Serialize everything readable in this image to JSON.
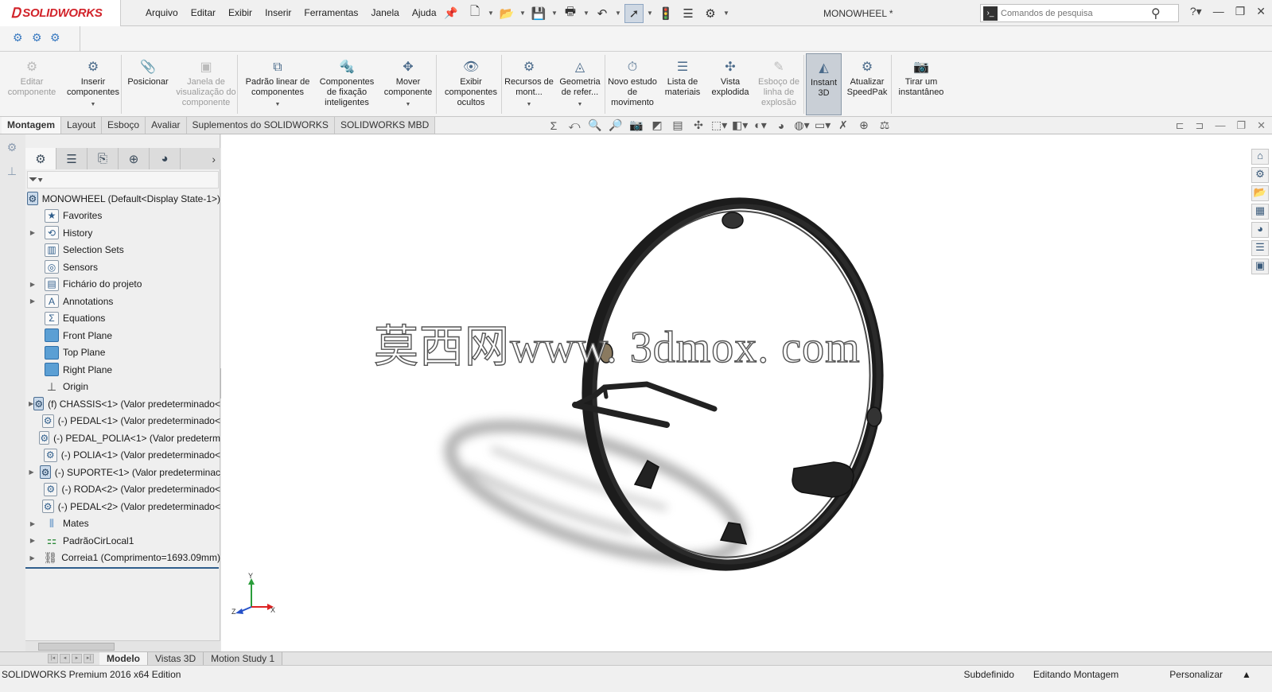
{
  "app": {
    "logo": "SOLIDWORKS",
    "document_title": "MONOWHEEL *",
    "menu": [
      "Arquivo",
      "Editar",
      "Exibir",
      "Inserir",
      "Ferramentas",
      "Janela",
      "Ajuda"
    ],
    "search_placeholder": "Comandos de pesquisa"
  },
  "command_manager": [
    {
      "label": "Editar componente",
      "disabled": true,
      "icon": "edit-component-icon"
    },
    {
      "label": "Inserir componentes",
      "disabled": false,
      "icon": "insert-components-icon",
      "caret": true
    },
    {
      "label": "Posicionar",
      "disabled": false,
      "icon": "mate-icon"
    },
    {
      "label": "Janela de visualização do componente",
      "disabled": true,
      "icon": "component-preview-icon"
    },
    {
      "label": "Padrão linear de componentes",
      "disabled": false,
      "icon": "linear-pattern-icon",
      "caret": true
    },
    {
      "label": "Componentes de fixação inteligentes",
      "disabled": false,
      "icon": "smart-fasteners-icon"
    },
    {
      "label": "Mover componente",
      "disabled": false,
      "icon": "move-component-icon",
      "caret": true
    },
    {
      "label": "Exibir componentes ocultos",
      "disabled": false,
      "icon": "show-hidden-icon"
    },
    {
      "label": "Recursos de mont...",
      "disabled": false,
      "icon": "assembly-features-icon",
      "caret": true
    },
    {
      "label": "Geometria de refer...",
      "disabled": false,
      "icon": "reference-geometry-icon",
      "caret": true
    },
    {
      "label": "Novo estudo de movimento",
      "disabled": false,
      "icon": "motion-study-icon"
    },
    {
      "label": "Lista de materiais",
      "disabled": false,
      "icon": "bom-icon"
    },
    {
      "label": "Vista explodida",
      "disabled": false,
      "icon": "exploded-view-icon"
    },
    {
      "label": "Esboço de linha de explosão",
      "disabled": true,
      "icon": "explode-line-sketch-icon"
    },
    {
      "label": "Instant 3D",
      "disabled": false,
      "active": true,
      "icon": "instant-3d-icon"
    },
    {
      "label": "Atualizar SpeedPak",
      "disabled": false,
      "icon": "speedpak-icon"
    },
    {
      "label": "Tirar um instantâneo",
      "disabled": false,
      "icon": "snapshot-icon"
    }
  ],
  "command_tabs": [
    "Montagem",
    "Layout",
    "Esboço",
    "Avaliar",
    "Suplementos do SOLIDWORKS",
    "SOLIDWORKS MBD"
  ],
  "active_command_tab": "Montagem",
  "tree": {
    "root": "MONOWHEEL  (Default<Display State-1>)",
    "items": [
      {
        "label": "Favorites",
        "expandable": false,
        "icon": "favorites-icon"
      },
      {
        "label": "History",
        "expandable": true,
        "icon": "history-icon"
      },
      {
        "label": "Selection Sets",
        "expandable": false,
        "icon": "selection-sets-icon"
      },
      {
        "label": "Sensors",
        "expandable": false,
        "icon": "sensors-icon"
      },
      {
        "label": "Fichário do projeto",
        "expandable": true,
        "icon": "design-binder-icon"
      },
      {
        "label": "Annotations",
        "expandable": true,
        "icon": "annotations-icon"
      },
      {
        "label": "Equations",
        "expandable": false,
        "icon": "equations-icon"
      },
      {
        "label": "Front Plane",
        "expandable": false,
        "icon": "plane-icon"
      },
      {
        "label": "Top Plane",
        "expandable": false,
        "icon": "plane-icon"
      },
      {
        "label": "Right Plane",
        "expandable": false,
        "icon": "plane-icon"
      },
      {
        "label": "Origin",
        "expandable": false,
        "icon": "origin-icon"
      },
      {
        "label": "(f) CHASSIS<1> (Valor predeterminado<",
        "expandable": true,
        "icon": "subassembly-icon"
      },
      {
        "label": "(-) PEDAL<1> (Valor predeterminado<",
        "expandable": false,
        "icon": "part-icon"
      },
      {
        "label": "(-) PEDAL_POLIA<1> (Valor predeterm",
        "expandable": false,
        "icon": "part-icon"
      },
      {
        "label": "(-) POLIA<1> (Valor predeterminado<",
        "expandable": false,
        "icon": "part-icon"
      },
      {
        "label": "(-) SUPORTE<1> (Valor predeterminac",
        "expandable": true,
        "icon": "subassembly-icon"
      },
      {
        "label": "(-) RODA<2> (Valor predeterminado<",
        "expandable": false,
        "icon": "part-icon"
      },
      {
        "label": "(-) PEDAL<2> (Valor predeterminado<",
        "expandable": false,
        "icon": "part-icon"
      },
      {
        "label": "Mates",
        "expandable": true,
        "icon": "mates-icon"
      },
      {
        "label": "PadrãoCirLocal1",
        "expandable": true,
        "icon": "circular-pattern-icon"
      },
      {
        "label": "Correia1 (Comprimento=1693.09mm)",
        "expandable": true,
        "icon": "belt-icon"
      }
    ]
  },
  "graphics": {
    "watermark": "莫西网www. 3dmox. com",
    "triad": {
      "x": "X",
      "y": "Y",
      "z": "Z"
    }
  },
  "bottom_tabs": [
    "Modelo",
    "Vistas 3D",
    "Motion Study 1"
  ],
  "active_bottom_tab": "Modelo",
  "status": {
    "left": "SOLIDWORKS Premium 2016 x64 Edition",
    "state": "Subdefinido",
    "mode": "Editando Montagem",
    "custom": "Personalizar"
  }
}
